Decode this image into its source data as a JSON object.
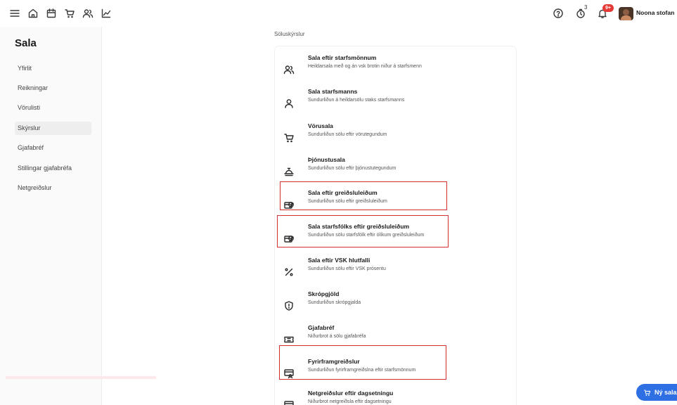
{
  "topbar": {
    "nav_icons": [
      "menu-icon",
      "home-icon",
      "calendar-icon",
      "cart-icon",
      "users-icon",
      "chart-icon"
    ],
    "help_icon": "help-icon",
    "timer_badge": "3",
    "notification_badge": "9+",
    "user_name": "Noona stofan"
  },
  "sidebar": {
    "title": "Sala",
    "items": [
      {
        "label": "Yfirlit"
      },
      {
        "label": "Reikningar"
      },
      {
        "label": "Vörulisti"
      },
      {
        "label": "Skýrslur",
        "active": true
      },
      {
        "label": "Gjafabréf"
      },
      {
        "label": "Stillingar gjafabréfa"
      },
      {
        "label": "Netgreiðslur"
      }
    ]
  },
  "main": {
    "section_label": "Söluskýrslur",
    "reports": [
      {
        "title": "Sala eftir starfsmönnum",
        "desc": "Heildarsala með og án vsk brotin niður á starfsmenn",
        "icon": "users-icon",
        "highlighted": false
      },
      {
        "title": "Sala starfsmanns",
        "desc": "Sundurliðun á heildarsölu staks starfsmanns",
        "icon": "user-icon",
        "highlighted": false
      },
      {
        "title": "Vörusala",
        "desc": "Sundurliðun sölu eftir vörutegundum",
        "icon": "cart-icon",
        "highlighted": false
      },
      {
        "title": "Þjónustusala",
        "desc": "Sundurliðun sölu eftir þjónustutegundum",
        "icon": "service-icon",
        "highlighted": false
      },
      {
        "title": "Sala eftir greiðsluleiðum",
        "desc": "Sundurliðun sölu eftir greiðsluleiðum",
        "icon": "payment-method-icon",
        "highlighted": true
      },
      {
        "title": "Sala starfsfólks eftir greiðsluleiðum",
        "desc": "Sundurliðun sölu starfsfólk eftir ólíkum greiðsluleiðum",
        "icon": "payment-method-icon",
        "highlighted": true
      },
      {
        "title": "Sala eftir VSK hlutfalli",
        "desc": "Sundurliðun sölu eftir VSK prósentu",
        "icon": "percent-icon",
        "highlighted": false
      },
      {
        "title": "Skrópgjöld",
        "desc": "Sundurliðun skrópgjalda",
        "icon": "shield-alert-icon",
        "highlighted": false
      },
      {
        "title": "Gjafabréf",
        "desc": "Niðurbrot á sölu gjafabréfa",
        "icon": "ticket-icon",
        "highlighted": false
      },
      {
        "title": "Fyrirframgreiðslur",
        "desc": "Sundurliðun fyrirframgreiðslna eftir starfsmönnum",
        "icon": "prepayment-icon",
        "highlighted": true
      },
      {
        "title": "Netgreiðslur eftir dagsetningu",
        "desc": "Niðurbrot netgreiðsla eftir dagsetningu",
        "icon": "online-payment-icon",
        "highlighted": false
      }
    ]
  },
  "new_sale_button": {
    "label": "Ný sala"
  },
  "colors": {
    "accent": "#2f6fe4",
    "highlight": "#d32f2f",
    "badge": "#e53935"
  }
}
